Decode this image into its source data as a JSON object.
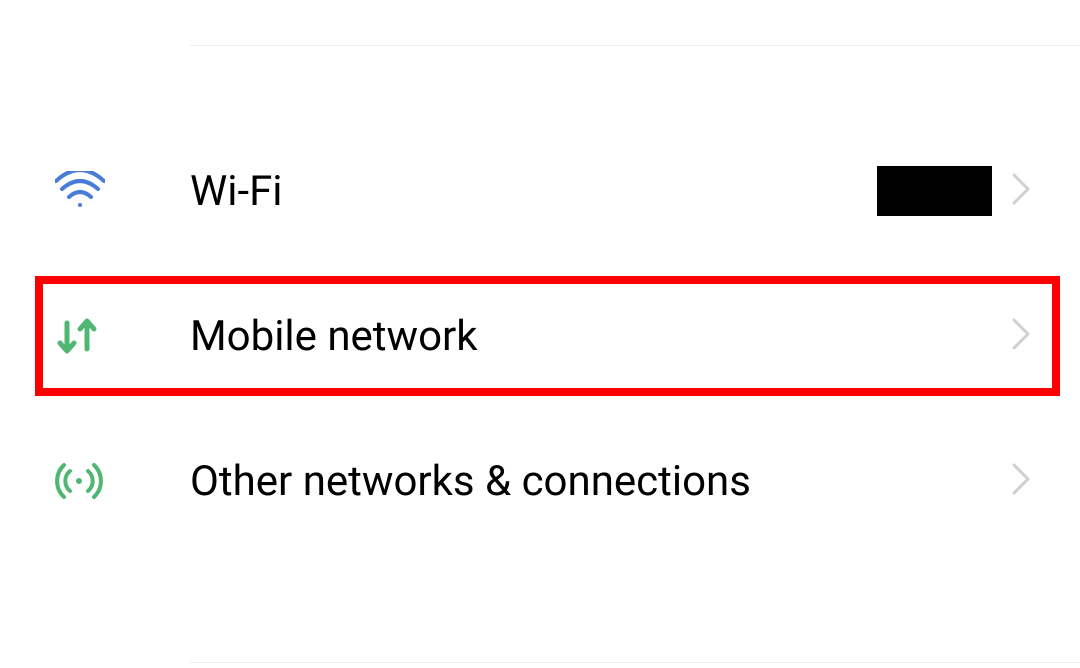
{
  "settings": {
    "items": [
      {
        "label": "Wi-Fi",
        "icon": "wifi-icon",
        "value_redacted": true
      },
      {
        "label": "Mobile network",
        "icon": "mobile-data-icon",
        "highlighted": true
      },
      {
        "label": "Other networks & connections",
        "icon": "hotspot-icon"
      }
    ]
  },
  "colors": {
    "wifi": "#4a7bd8",
    "mobile": "#4fb772",
    "hotspot": "#4fb772",
    "highlight_border": "#ff0000"
  }
}
